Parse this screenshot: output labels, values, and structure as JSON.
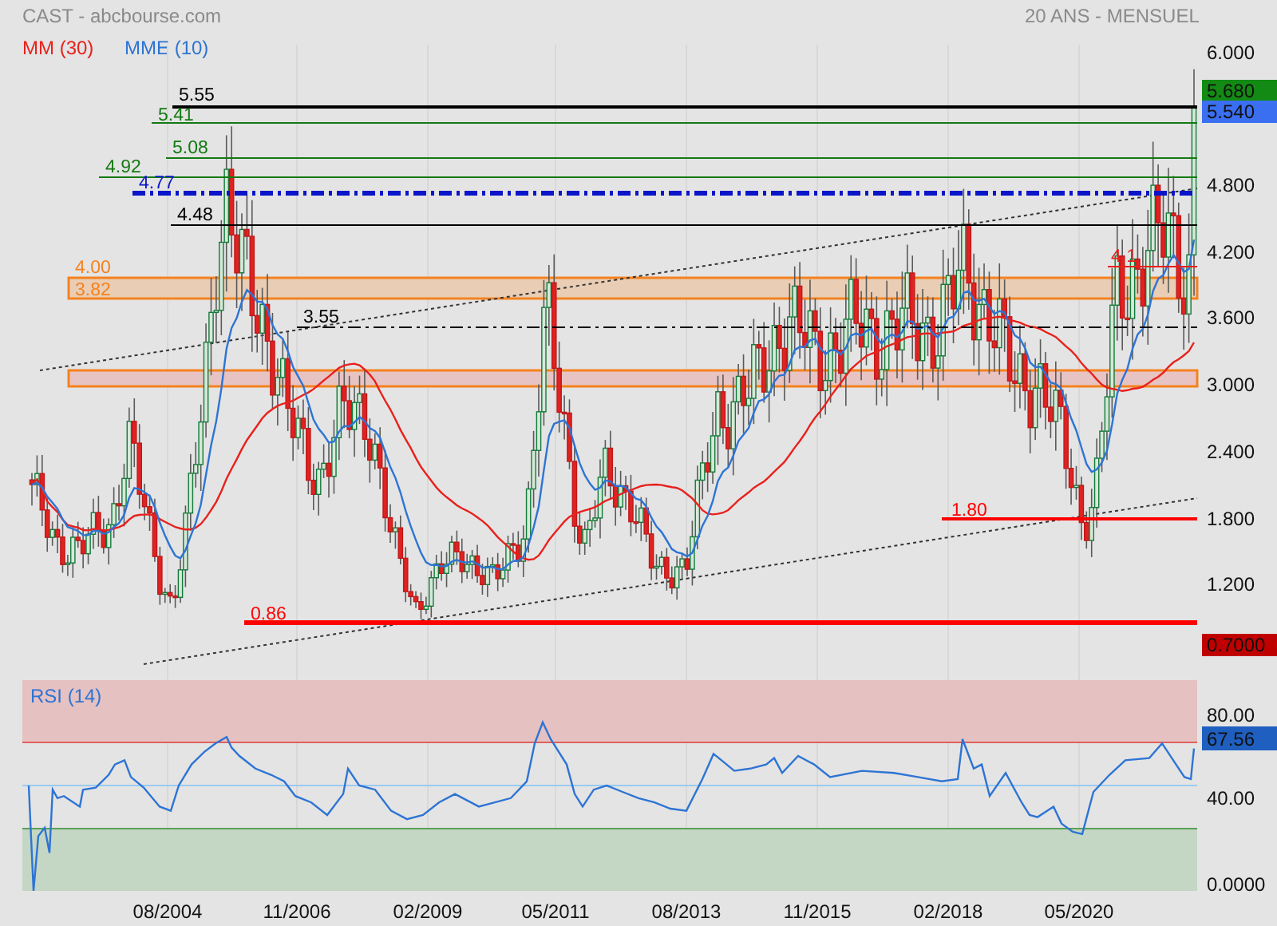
{
  "header": {
    "title": "CAST - abcbourse.com",
    "period": "20 ANS - MENSUEL"
  },
  "legend": [
    {
      "label": "MM (30)",
      "color": "#e8211c"
    },
    {
      "label": "MME (10)",
      "color": "#2d74d4"
    }
  ],
  "price_panel": {
    "y_axis": [
      "6.000",
      "4.800",
      "4.200",
      "3.600",
      "3.000",
      "2.400",
      "1.800",
      "1.200"
    ],
    "badges": [
      {
        "label": "5.680",
        "color": "#138a13"
      },
      {
        "label": "5.540",
        "color": "#3b6ff2"
      },
      {
        "label": "0.7000",
        "color": "#c00000"
      }
    ],
    "levels": [
      {
        "label": "5.55",
        "color": "#000000",
        "kind": "solid"
      },
      {
        "label": "5.41",
        "color": "#137a13",
        "kind": "solid"
      },
      {
        "label": "5.08",
        "color": "#137a13",
        "kind": "solid"
      },
      {
        "label": "4.92",
        "color": "#137a13",
        "kind": "solid"
      },
      {
        "label": "4.77",
        "color": "#0a14c8",
        "kind": "dashdot"
      },
      {
        "label": "4.48",
        "color": "#000000",
        "kind": "solid"
      },
      {
        "label": "3.55",
        "color": "#000000",
        "kind": "dashdot"
      },
      {
        "label": "4.1",
        "color": "#e8211c",
        "kind": "solid"
      },
      {
        "label": "1.80",
        "color": "#ff0000",
        "kind": "solid"
      },
      {
        "label": "0.86",
        "color": "#ff0000",
        "kind": "solid"
      }
    ],
    "bands": [
      {
        "top_label": "4.00",
        "bottom_label": "3.82",
        "color": "#f5821f"
      },
      {
        "color": "#f5821f"
      }
    ]
  },
  "x_axis": [
    "08/2004",
    "11/2006",
    "02/2009",
    "05/2011",
    "08/2013",
    "11/2015",
    "02/2018",
    "05/2020"
  ],
  "rsi": {
    "label": "RSI (14)",
    "y_axis": [
      "80.00",
      "40.00",
      "0.0000"
    ],
    "badge": "67.56"
  }
}
